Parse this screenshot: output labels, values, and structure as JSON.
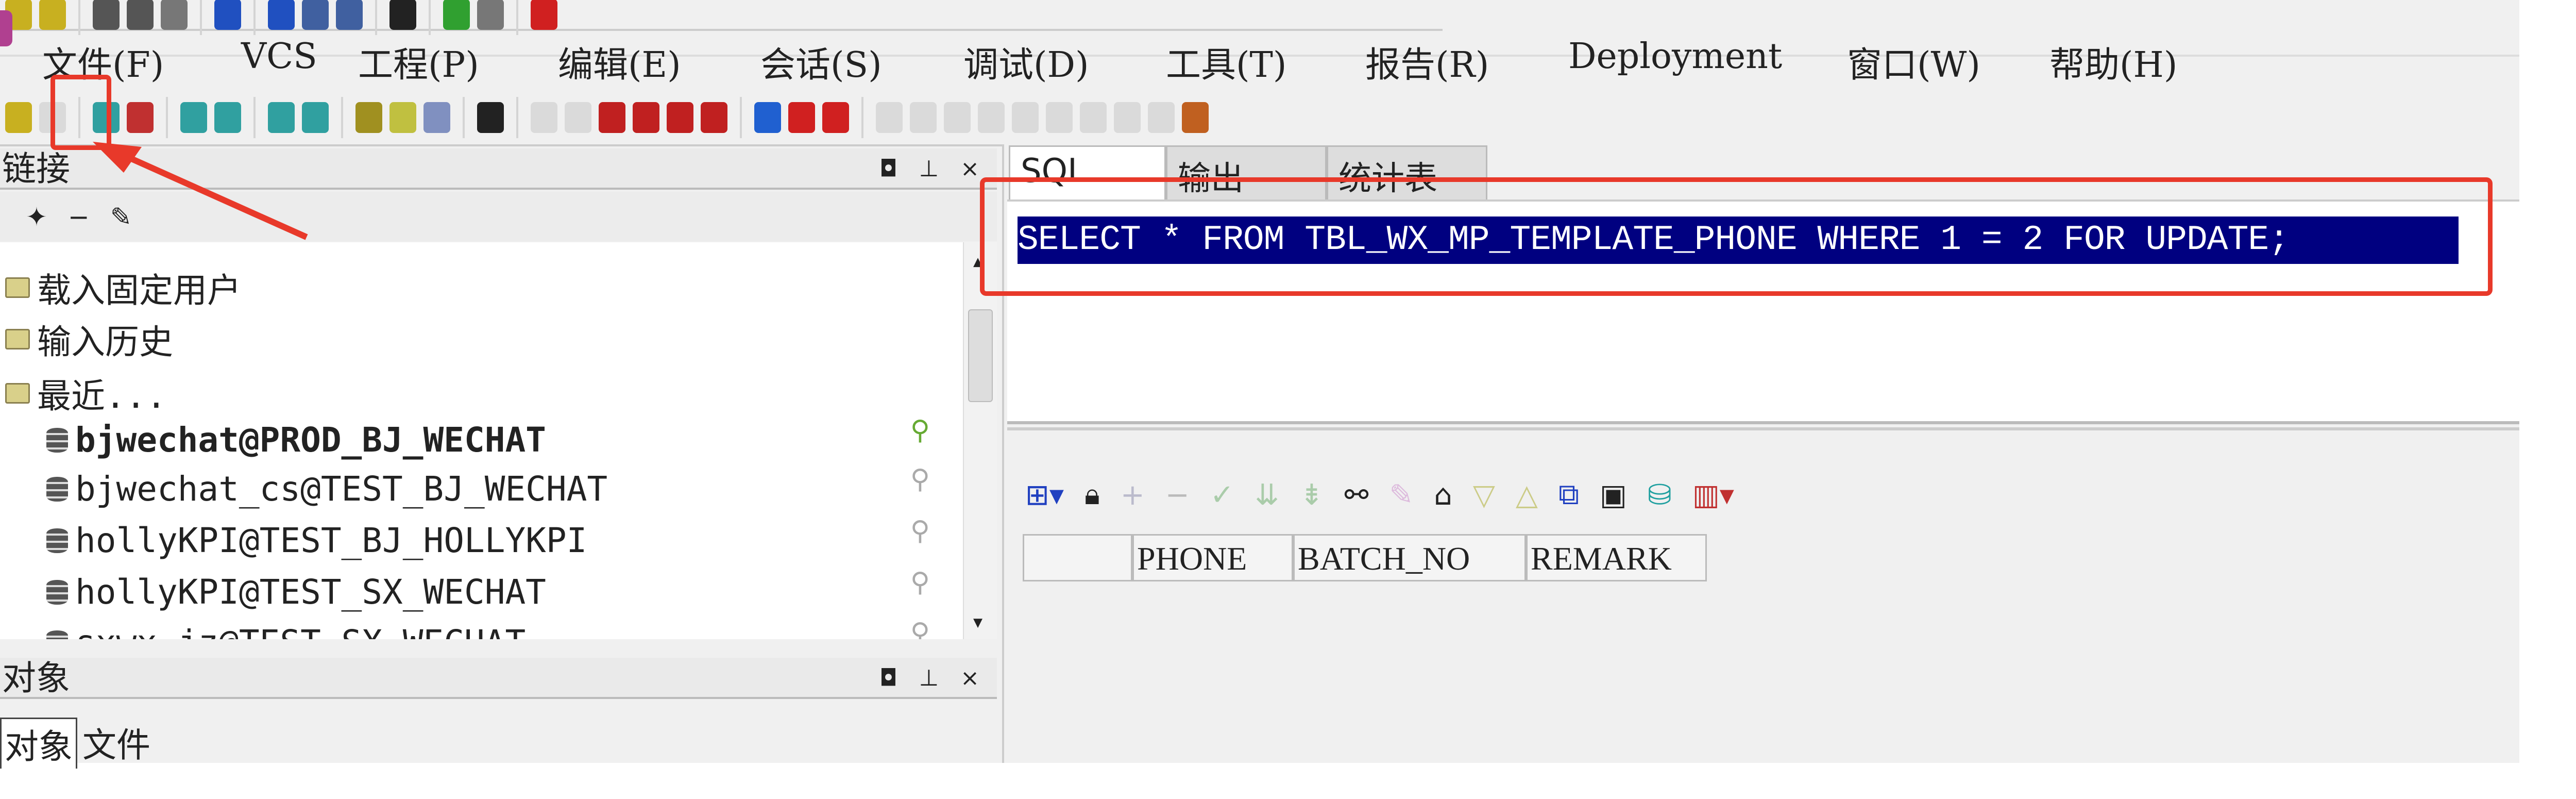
{
  "menu": [
    "文件(F)",
    "VCS",
    "工程(P)",
    "编辑(E)",
    "会话(S)",
    "调试(D)",
    "工具(T)",
    "报告(R)",
    "Deployment",
    "窗口(W)",
    "帮助(H)"
  ],
  "top_toolbar_icons": [
    {
      "name": "open-icon",
      "color": "#c8b020"
    },
    {
      "name": "open-recent-icon",
      "color": "#c8b020"
    },
    {
      "name": "save-icon",
      "color": "#555"
    },
    {
      "name": "save-all-icon",
      "color": "#555"
    },
    {
      "name": "print-icon",
      "color": "#777"
    },
    {
      "name": "undo-icon",
      "color": "#2050c0"
    },
    {
      "name": "cut-icon",
      "color": "#2050c0"
    },
    {
      "name": "copy-icon",
      "color": "#4060a0"
    },
    {
      "name": "paste-icon",
      "color": "#4060a0"
    },
    {
      "name": "find-icon",
      "color": "#222"
    },
    {
      "name": "run-icon",
      "color": "#30a030"
    },
    {
      "name": "commit-icon",
      "color": "#777"
    },
    {
      "name": "help-icon",
      "color": "#d02020"
    }
  ],
  "toolbar2_icons": [
    {
      "name": "connect-icon",
      "color": "#c8b020",
      "highlight": true
    },
    {
      "name": "disconnect-icon",
      "color": "#ccc"
    },
    {
      "name": "import-icon",
      "color": "#30a0a0"
    },
    {
      "name": "export-icon",
      "color": "#c03030"
    },
    {
      "name": "sql-icon",
      "color": "#30a0a0"
    },
    {
      "name": "psql-icon",
      "color": "#30a0a0"
    },
    {
      "name": "db-icon",
      "color": "#30a0a0"
    },
    {
      "name": "db-remove-icon",
      "color": "#30a0a0"
    },
    {
      "name": "compile-icon",
      "color": "#a09020"
    },
    {
      "name": "checklist-icon",
      "color": "#c0c040"
    },
    {
      "name": "report-icon",
      "color": "#8090c0"
    },
    {
      "name": "wrench-icon",
      "color": "#222"
    },
    {
      "name": "bookmark-icon",
      "color": "#ccc"
    },
    {
      "name": "clear-icon",
      "color": "#ccc"
    },
    {
      "name": "red-gem-icon",
      "color": "#c02020"
    },
    {
      "name": "red-gem-2-icon",
      "color": "#c02020"
    },
    {
      "name": "red-gem-3-icon",
      "color": "#c02020"
    },
    {
      "name": "red-gem-4-icon",
      "color": "#c02020"
    },
    {
      "name": "arrow-right-blue-icon",
      "color": "#2060d0"
    },
    {
      "name": "arrow-right-red-icon",
      "color": "#d02020"
    },
    {
      "name": "arrow-left-red-icon",
      "color": "#d02020"
    },
    {
      "name": "debug-icon",
      "color": "#ccc"
    },
    {
      "name": "debug-2-icon",
      "color": "#ccc"
    },
    {
      "name": "debug-3-icon",
      "color": "#ccc"
    },
    {
      "name": "debug-4-icon",
      "color": "#ccc"
    },
    {
      "name": "debug-5-icon",
      "color": "#ccc"
    },
    {
      "name": "debug-6-icon",
      "color": "#ccc"
    },
    {
      "name": "debug-7-icon",
      "color": "#ccc"
    },
    {
      "name": "debug-8-icon",
      "color": "#ccc"
    },
    {
      "name": "debug-9-icon",
      "color": "#ccc"
    },
    {
      "name": "lock-icon",
      "color": "#c06020"
    }
  ],
  "connections_panel": {
    "title": "链接",
    "controls": "◘ ⊥ ×",
    "tree": [
      {
        "label": "载入固定用户",
        "type": "folder"
      },
      {
        "label": "输入历史",
        "type": "folder"
      },
      {
        "label": "最近...",
        "type": "folder"
      },
      {
        "label": "bjwechat@PROD_BJ_WECHAT",
        "type": "db",
        "bold": true
      },
      {
        "label": "bjwechat_cs@TEST_BJ_WECHAT",
        "type": "db"
      },
      {
        "label": "hollyKPI@TEST_BJ_HOLLYKPI",
        "type": "db"
      },
      {
        "label": "hollyKPI@TEST_SX_WECHAT",
        "type": "db"
      },
      {
        "label": "sxwx_jz@TEST_SX_WECHAT",
        "type": "db"
      }
    ]
  },
  "objects_panel": {
    "title": "对象",
    "controls": "◘ ⊥ ×",
    "tabs": [
      "对象",
      "文件"
    ]
  },
  "editor": {
    "tabs": [
      "SQL",
      "输出",
      "统计表"
    ],
    "sql": "SELECT * FROM TBL_WX_MP_TEMPLATE_PHONE WHERE 1 = 2 FOR UPDATE;"
  },
  "results": {
    "columns": [
      "PHONE",
      "BATCH_NO",
      "REMARK"
    ]
  },
  "colors": {
    "annotation": "#e8392a",
    "selection": "#000080"
  }
}
